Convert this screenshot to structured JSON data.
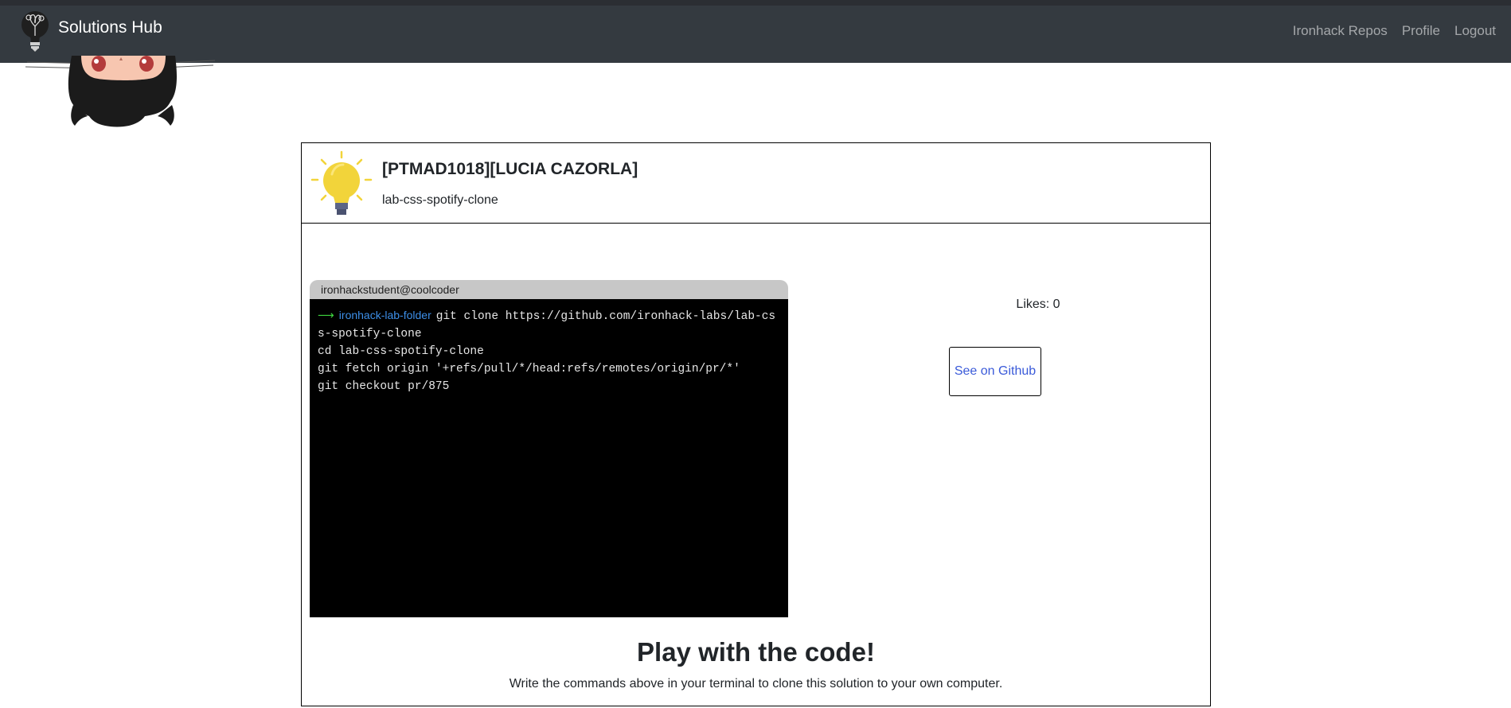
{
  "navbar": {
    "brand": "Solutions Hub",
    "brand_icon": "lightbulb-logo-icon",
    "links": [
      "Ironhack Repos",
      "Profile",
      "Logout"
    ]
  },
  "solution": {
    "title": "[PTMAD1018][LUCIA CAZORLA]",
    "repo": "lab-css-spotify-clone",
    "icon": "lightbulb-icon"
  },
  "terminal": {
    "bar_label": "ironhackstudent@coolcoder",
    "prompt_arrow": "⟶",
    "prompt_folder": "ironhack-lab-folder",
    "lines": [
      "git clone https://github.com/ironhack-labs/lab-css-spotify-clone",
      "cd lab-css-spotify-clone",
      "git fetch origin '+refs/pull/*/head:refs/remotes/origin/pr/*'",
      "git checkout pr/875"
    ]
  },
  "likes": "Likes: 0",
  "github_button": "See on Github",
  "play": {
    "title": "Play with the code!",
    "subtitle": "Write the commands above in your terminal to clone this solution to your own computer."
  },
  "colors": {
    "navbar_bg": "#343a40",
    "terminal_bg": "#000000",
    "prompt_arrow": "#3ed23e",
    "prompt_folder": "#3d8fe8",
    "link_blue": "#3a5ad9",
    "bulb_yellow": "#f2d43a"
  }
}
